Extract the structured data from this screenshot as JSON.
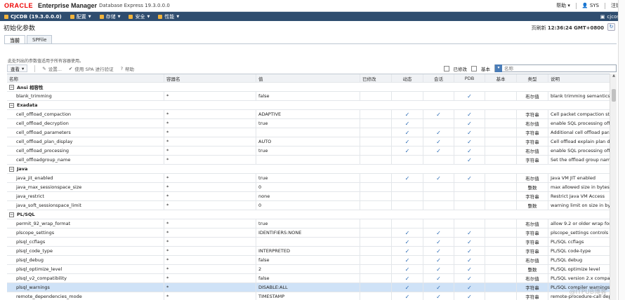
{
  "header": {
    "logo": "ORACLE",
    "app_name": "Enterprise Manager",
    "app_version": "Database Express 19.3.0.0.0",
    "help_label": "帮助",
    "user_label": "SYS",
    "logout_label": "注销"
  },
  "nav": {
    "db_label": "CJCDB (19.3.0.0.0)",
    "items": [
      {
        "label": "配置"
      },
      {
        "label": "存储"
      },
      {
        "label": "安全"
      },
      {
        "label": "性能"
      }
    ],
    "user_host": "cjcos"
  },
  "page": {
    "title": "初始化参数",
    "refresh_label": "页刷新",
    "refresh_time": "12:36:24 GMT+0800"
  },
  "tabs": [
    {
      "label": "当前",
      "active": true
    },
    {
      "label": "SPFile",
      "active": false
    }
  ],
  "hint": "此处列出的参数值适用于所有容器使用。",
  "toolbar": {
    "view_label": "查看",
    "set_label": "设置...",
    "spa_label": "使用 SPA 进行验证",
    "help_label": "帮助",
    "modified_label": "已修改",
    "basic_label": "基本",
    "filter_placeholder": "名称"
  },
  "columns": {
    "name": "名称",
    "default": "容器名",
    "value": "值",
    "modified": "已修改",
    "dynamic": "动态",
    "session": "会话",
    "pdb": "PDB",
    "basic": "基本",
    "type": "类型",
    "desc": "说明"
  },
  "groups": [
    {
      "label": "Ansi 相容性",
      "rows": [
        {
          "name": "blank_trimming",
          "container": "*",
          "value": "false",
          "dynamic": false,
          "session": false,
          "pdb": true,
          "type": "布尔值",
          "desc": "blank trimming semantics p..."
        }
      ]
    },
    {
      "label": "Exadata",
      "rows": [
        {
          "name": "cell_offload_compaction",
          "container": "*",
          "value": "ADAPTIVE",
          "dynamic": true,
          "session": true,
          "pdb": true,
          "type": "字符串",
          "desc": "Cell packet compaction strat..."
        },
        {
          "name": "cell_offload_decryption",
          "container": "*",
          "value": "true",
          "dynamic": true,
          "session": false,
          "pdb": true,
          "type": "布尔值",
          "desc": "enable SQL processing offlo..."
        },
        {
          "name": "cell_offload_parameters",
          "container": "*",
          "value": "",
          "dynamic": true,
          "session": true,
          "pdb": true,
          "type": "字符串",
          "desc": "Additional cell offload para..."
        },
        {
          "name": "cell_offload_plan_display",
          "container": "*",
          "value": "AUTO",
          "dynamic": true,
          "session": true,
          "pdb": true,
          "type": "字符串",
          "desc": "Cell offload explain plan dis..."
        },
        {
          "name": "cell_offload_processing",
          "container": "*",
          "value": "true",
          "dynamic": true,
          "session": true,
          "pdb": true,
          "type": "布尔值",
          "desc": "enable SQL processing offlo..."
        },
        {
          "name": "cell_offloadgroup_name",
          "container": "*",
          "value": "",
          "dynamic": false,
          "session": false,
          "pdb": true,
          "type": "字符串",
          "desc": "Set the offload group name"
        }
      ]
    },
    {
      "label": "Java",
      "rows": [
        {
          "name": "java_jit_enabled",
          "container": "*",
          "value": "true",
          "dynamic": true,
          "session": true,
          "pdb": true,
          "type": "布尔值",
          "desc": "Java VM JIT enabled"
        },
        {
          "name": "java_max_sessionspace_size",
          "container": "*",
          "value": "0",
          "dynamic": false,
          "session": false,
          "pdb": false,
          "type": "整数",
          "desc": "max allowed size in bytes of..."
        },
        {
          "name": "java_restrict",
          "container": "*",
          "value": "none",
          "dynamic": false,
          "session": false,
          "pdb": false,
          "type": "字符串",
          "desc": "Restrict Java VM Access"
        },
        {
          "name": "java_soft_sessionspace_limit",
          "container": "*",
          "value": "0",
          "dynamic": false,
          "session": false,
          "pdb": false,
          "type": "整数",
          "desc": "warning limit on size in byte..."
        }
      ]
    },
    {
      "label": "PL/SQL",
      "rows": [
        {
          "name": "permit_92_wrap_format",
          "container": "*",
          "value": "true",
          "dynamic": false,
          "session": false,
          "pdb": false,
          "type": "布尔值",
          "desc": "allow 9.2 or older wrap for..."
        },
        {
          "name": "plscope_settings",
          "container": "*",
          "value": "IDENTIFIERS:NONE",
          "dynamic": true,
          "session": true,
          "pdb": true,
          "type": "字符串",
          "desc": "plscope_settings controls th..."
        },
        {
          "name": "plsql_ccflags",
          "container": "*",
          "value": "",
          "dynamic": true,
          "session": true,
          "pdb": true,
          "type": "字符串",
          "desc": "PL/SQL ccflags"
        },
        {
          "name": "plsql_code_type",
          "container": "*",
          "value": "INTERPRETED",
          "dynamic": true,
          "session": true,
          "pdb": true,
          "type": "字符串",
          "desc": "PL/SQL code-type"
        },
        {
          "name": "plsql_debug",
          "container": "*",
          "value": "false",
          "dynamic": true,
          "session": true,
          "pdb": true,
          "type": "布尔值",
          "desc": "PL/SQL debug"
        },
        {
          "name": "plsql_optimize_level",
          "container": "*",
          "value": "2",
          "dynamic": true,
          "session": true,
          "pdb": true,
          "type": "整数",
          "desc": "PL/SQL optimize level"
        },
        {
          "name": "plsql_v2_compatibility",
          "container": "*",
          "value": "false",
          "dynamic": true,
          "session": true,
          "pdb": true,
          "type": "布尔值",
          "desc": "PL/SQL version 2.x compat..."
        },
        {
          "name": "plsql_warnings",
          "container": "*",
          "value": "DISABLE:ALL",
          "dynamic": true,
          "session": true,
          "pdb": true,
          "type": "字符串",
          "desc": "PL/SQL compiler warnings ...",
          "selected": true
        },
        {
          "name": "remote_dependencies_mode",
          "container": "*",
          "value": "TIMESTAMP",
          "dynamic": true,
          "session": true,
          "pdb": true,
          "type": "字符串",
          "desc": "remote-procedure-call depe..."
        }
      ]
    }
  ],
  "check_glyph": "✓",
  "watermark": "@ITPUB博客"
}
